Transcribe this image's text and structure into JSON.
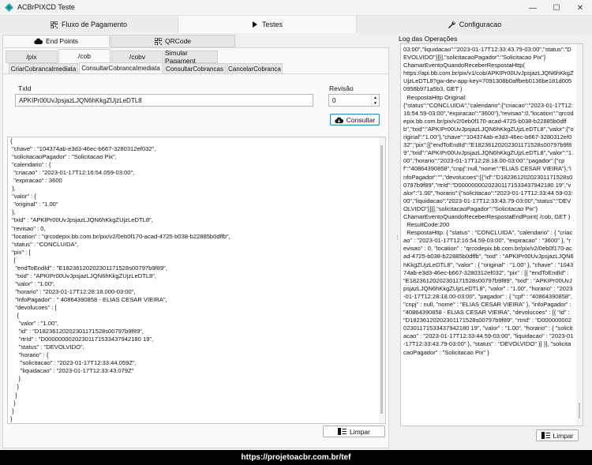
{
  "window": {
    "title": "ACBrPIXCD Teste",
    "minimize": "—",
    "maximize": "☐",
    "close": "✕"
  },
  "main_tabs": [
    {
      "label": "Fluxo de Pagamento",
      "icon": "qr-code-icon"
    },
    {
      "label": "Testes",
      "icon": "play-icon"
    },
    {
      "label": "Configuracao",
      "icon": "wrench-icon"
    }
  ],
  "sub_tabs": [
    {
      "label": "End Points",
      "icon": "cloud-icon"
    },
    {
      "label": "QRCode",
      "icon": "qr-code-icon"
    }
  ],
  "endpoint_tabs": [
    "/pix",
    "/cob",
    "/cobv",
    "Simular Pagament"
  ],
  "action_tabs": [
    "CriarCobrancaImediata",
    "ConsultarCobrancaImediata",
    "ConsultarCobrancas",
    "CancelarCobranca"
  ],
  "form": {
    "txid_label": "TxId",
    "txid_value": "APKIPr00UvJpsjazLJQN6hKkgZUjzLeDTL8",
    "revisao_label": "Revisão",
    "revisao_value": "0",
    "consultar_label": "Consultar"
  },
  "result_json": "{\n \"chave\" : \"104374ab-e3d3-46ec-b667-3280312ef032\",\n \"solicitacaoPagador\" : \"Solicitacao Pix\",\n \"calendario\" : {\n  \"criacao\" : \"2023-01-17T12:16:54.059-03:00\",\n  \"expiracao\" : 3600\n },\n \"valor\" : {\n  \"original\" : \"1.00\"\n },\n \"txid\" : \"APKIPr00UvJpsjazLJQN6hKkgZUjzLeDTL8\",\n \"revisao\" : 0,\n \"location\" : \"qrcodepix.bb.com.br/pix/v2/0eb0f170-acad-4725-b038-b22885b0dffb\",\n \"status\" : \"CONCLUIDA\",\n \"pix\" : [\n  {\n   \"endToEndId\" : \"E18236120202301171528s00797b9f89\",\n   \"txid\" : \"APKIPr00UvJpsjazLJQN6hKkgZUjzLeDTL8\",\n   \"valor\" : \"1.00\",\n   \"horario\" : \"2023-01-17T12:28:18.000-03:00\",\n   \"infoPagador\" : \" 40864390858 - ELIAS CESAR VIEIRA\",\n   \"devolucoes\" : [\n    {\n     \"valor\" : \"1.00\",\n     \"id\" : \"D18236120202301171528s00797b9f89\",\n     \"rtrId\" : \"D00000000202301171533437942180 19\",\n     \"status\" : \"DEVOLVIDO\",\n     \"horario\" : {\n      \"solicitacao\" : \"2023-01-17T12:33:44.059Z\",\n      \"liquidacao\" : \"2023-01-17T12:33:43.079Z\"\n     }\n    }\n   ]\n  }\n ]\n}",
  "limpar_label": "Limpar",
  "log": {
    "title": "Log das Operações",
    "text": "03:00\",\"liquidacao\":\"2023-01-17T12:33:43.79-03:00\",\"status\":\"DEVOLVIDO\"}]}],\"solicitacaoPagador\":\"Solicitacao Pix\"}\nChamarEventoQuandoReceberRespostaHttp(\nhttps://api.bb.com.br/pix/v1/cob/APKIPr00UvJpsjazLJQN6hKkgZUjzLeDTL8?gw-dev-app-key=7091308b0affbeb0136be181d0050956b971a5b3, GET )\n  RespostaHttp Original:\n{\"status\":\"CONCLUIDA\",\"calendario\":{\"criacao\":\"2023-01-17T12:16:54.59-03:00\",\"expiracao\":\"3600\"},\"revisao\":0,\"location\":\"qrcodepix.bb.com.br/pix/v2/0eb0f170-acad-4725-b038-b22885b0dffb\",\"txid\":\"APKIPr00UvJpsjazLJQN6hKkgZUjzLeDTL8\",\"valor\":{\"original\":\"1.00\"},\"chave\":\"104374ab-e3d3-46ec-b667-3280312ef032\",\"pix\":[{\"endToEndId\":\"E18236120202301171528s00797b9f89\",\"txid\":\"APKIPr00UvJpsjazLJQN6hKkgZUjzLeDTL8\",\"valor\":\"1.00\",\"horario\":\"2023-01-17T12:28:18.00-03:00\",\"pagador\":{\"cpf\":\"40864390858\",\"cnpj\":null,\"nome\":\"ELIAS CESAR VIEIRA\"},\"infoPagador\":\"\",\"devolucoes\":[{\"id\":\"D18236120202301171528s00797b9f89\",\"rtrId\":\"D00000000202301171533437942180 19\",\"valor\":\"1.00\",\"horario\":{\"solicitacao\":\"2023-01-17T12:33:44.59-03:00\",\"liquidacao\":\"2023-01-17T12:33:43.79-03:00\",\"status\":\"DEVOLVIDO\"}]}],\"solicitacaoPagador\":\"Solicitacao Pix\"}\nChamarEventoQuandoReceberRespostaEndPoint( /cob, GET )\n  ResultCode:200\n  RespostaHttp: { \"status\" : \"CONCLUIDA\", \"calendario\" : { \"criacao\" : \"2023-01-17T12:16:54.59-03:00\", \"expiracao\" : \"3600\" }, \"revisao\" : 0, \"location\" : \"qrcodepix.bb.com.br/pix/v2/0eb0f170-acad-4725-b038-b22885b0dffb\", \"txid\" : \"APKIPr00UvJpsjazLJQN6hKkgZUjzLeDTL8\", \"valor\" : { \"original\" : \"1.00\" }, \"chave\" : \"104374ab-e3d3-46ec-b667-3280312ef032\", \"pix\" : [{ \"endToEndId\" : \"E18236120202301171528s00797b9f89\", \"txid\" : \"APKIPr00UvJpsjazLJQN6hKkgZUjzLeDTL8\", \"valor\" : \"1.00\", \"horario\" : \"2023-01-17T12:28:18.00-03:00\", \"pagador\" : { \"cpf\" : \"40864390858\", \"cnpj\" : null, \"nome\" : \"ELIAS CESAR VIEIRA\" }, \"infoPagador\" : \"40864390858 - ELIAS CESAR VIEIRA\", \"devolucoes\" : [{ \"id\" : \"D18236120202301171528s00797b9f89\", \"rtrId\" : \"D00000000202301171533437942180 19\", \"valor\" : \"1.00\", \"horario\" : { \"solicitacao\" : \"2023-01-17T12:33:44.59-03:00\", \"liquidacao\" : \"2023-01-17T12:33:43.79-03:00\" }, \"status\" : \"DEVOLVIDO\" }] }], \"solicitacaoPagador\" : \"Solicitacao Pix\" }"
  },
  "footer_url": "https://projetoacbr.com.br/tef",
  "colors": {
    "accent": "#2b8fc9",
    "footer_bg": "#000000"
  }
}
